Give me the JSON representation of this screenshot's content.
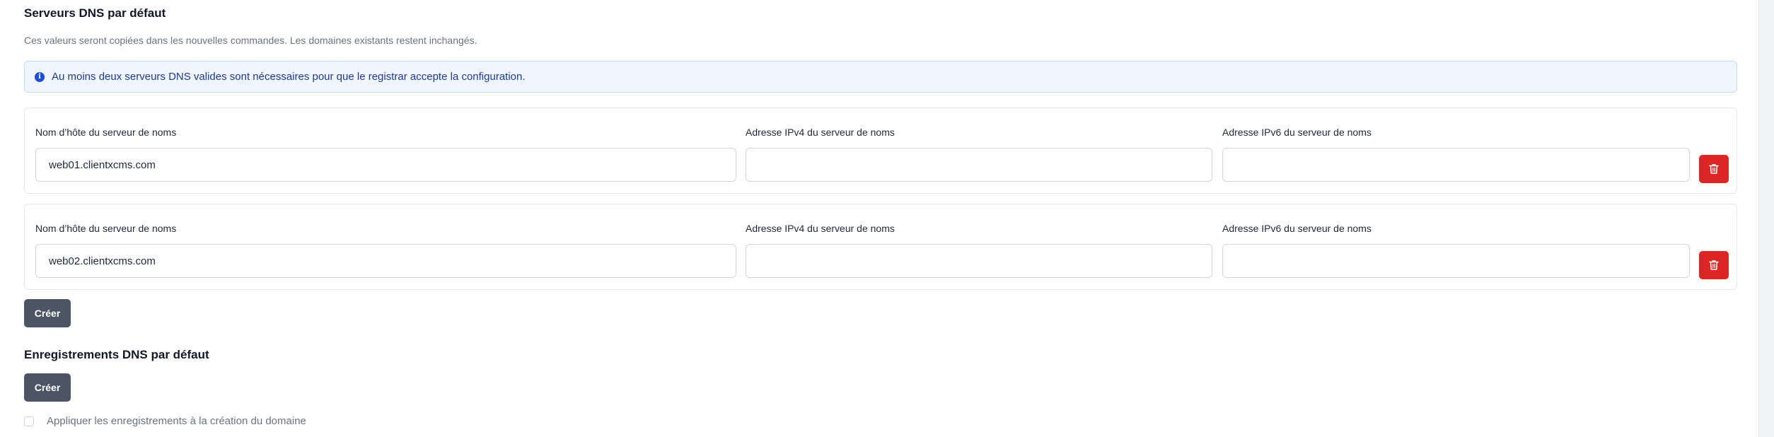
{
  "nameservers_section": {
    "title": "Serveurs DNS par défaut",
    "description": "Ces valeurs seront copiées dans les nouvelles commandes. Les domaines existants restent inchangés.",
    "alert_text": "Au moins deux serveurs DNS valides sont nécessaires pour que le registrar accepte la configuration.",
    "alert_icon": "info-icon",
    "labels": {
      "hostname": "Nom d’hôte du serveur de noms",
      "ipv4": "Adresse IPv4 du serveur de noms",
      "ipv6": "Adresse IPv6 du serveur de noms"
    },
    "entries": [
      {
        "hostname": "web01.clientxcms.com",
        "ipv4": "",
        "ipv6": ""
      },
      {
        "hostname": "web02.clientxcms.com",
        "ipv4": "",
        "ipv6": ""
      }
    ],
    "delete_icon": "trash-icon",
    "create_label": "Créer"
  },
  "records_section": {
    "title": "Enregistrements DNS par défaut",
    "create_label": "Créer",
    "apply_checkbox_label": "Appliquer les enregistrements à la création du domaine",
    "apply_checked": false
  },
  "colors": {
    "danger": "#dc2626",
    "secondary": "#4b5563",
    "info_bg": "#eff6ff",
    "info_text": "#1e3a8a"
  }
}
